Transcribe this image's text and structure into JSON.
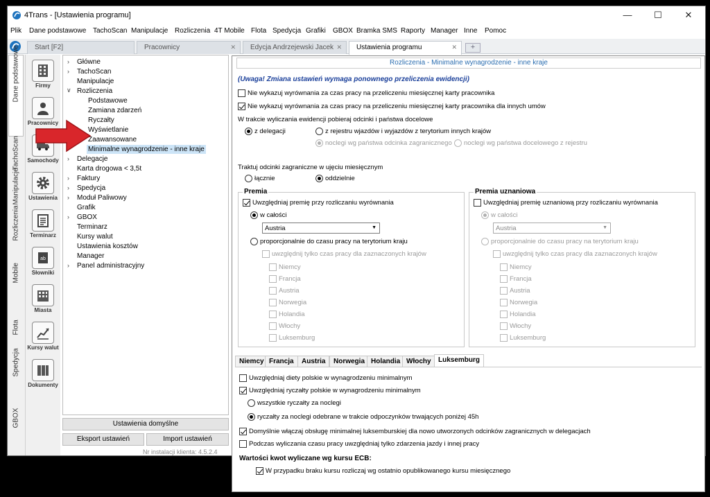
{
  "window": {
    "title": "4Trans - [Ustawienia programu]"
  },
  "menu": [
    "Plik",
    "Dane podstawowe",
    "TachoScan",
    "Manipulacje",
    "Rozliczenia",
    "4T Mobile",
    "Flota",
    "Spedycja",
    "Grafiki",
    "GBOX",
    "Bramka SMS",
    "Raporty",
    "Manager",
    "Inne",
    "Pomoc"
  ],
  "tabs": [
    {
      "label": "Start [F2]",
      "closable": false
    },
    {
      "label": "Pracownicy",
      "closable": true
    },
    {
      "label": "Edycja Andrzejewski Jacek",
      "closable": true
    },
    {
      "label": "Ustawienia programu",
      "closable": true,
      "active": true
    }
  ],
  "vertical_tabs": [
    "Dane podstawowe",
    "TachoScan",
    "Manipulacje",
    "Rozliczenia",
    "Mobile",
    "Flota",
    "Spedycja",
    "GBOX"
  ],
  "icon_buttons": [
    {
      "label": "Firmy",
      "icon": "building-icon"
    },
    {
      "label": "Pracownicy",
      "icon": "person-icon"
    },
    {
      "label": "Samochody",
      "icon": "truck-icon"
    },
    {
      "label": "Ustawienia",
      "icon": "gear-icon"
    },
    {
      "label": "Terminarz",
      "icon": "calendar-icon"
    },
    {
      "label": "Słowniki",
      "icon": "dictionary-icon"
    },
    {
      "label": "Miasta",
      "icon": "city-icon"
    },
    {
      "label": "Kursy walut",
      "icon": "chart-icon"
    },
    {
      "label": "Dokumenty",
      "icon": "documents-icon"
    }
  ],
  "tree": [
    {
      "label": "Główne",
      "level": 0,
      "chevron": "right"
    },
    {
      "label": "TachoScan",
      "level": 0,
      "chevron": "right"
    },
    {
      "label": "Manipulacje",
      "level": 0,
      "chevron": ""
    },
    {
      "label": "Rozliczenia",
      "level": 0,
      "chevron": "down"
    },
    {
      "label": "Podstawowe",
      "level": 1,
      "chevron": ""
    },
    {
      "label": "Zamiana zdarzeń",
      "level": 1,
      "chevron": ""
    },
    {
      "label": "Ryczałty",
      "level": 1,
      "chevron": ""
    },
    {
      "label": "Wyświetlanie",
      "level": 1,
      "chevron": ""
    },
    {
      "label": "Zaawansowane",
      "level": 1,
      "chevron": ""
    },
    {
      "label": "Minimalne wynagrodzenie - inne kraje",
      "level": 1,
      "chevron": "",
      "selected": true
    },
    {
      "label": "Delegacje",
      "level": 0,
      "chevron": "right"
    },
    {
      "label": "Karta drogowa < 3,5t",
      "level": 0,
      "chevron": ""
    },
    {
      "label": "Faktury",
      "level": 0,
      "chevron": "right"
    },
    {
      "label": "Spedycja",
      "level": 0,
      "chevron": "right"
    },
    {
      "label": "Moduł Paliwowy",
      "level": 0,
      "chevron": "right"
    },
    {
      "label": "Grafik",
      "level": 0,
      "chevron": ""
    },
    {
      "label": "GBOX",
      "level": 0,
      "chevron": "right"
    },
    {
      "label": "Terminarz",
      "level": 0,
      "chevron": ""
    },
    {
      "label": "Kursy walut",
      "level": 0,
      "chevron": ""
    },
    {
      "label": "Ustawienia kosztów",
      "level": 0,
      "chevron": ""
    },
    {
      "label": "Manager",
      "level": 0,
      "chevron": ""
    },
    {
      "label": "Panel administracyjny",
      "level": 0,
      "chevron": "right"
    }
  ],
  "left_buttons": {
    "defaults": "Ustawienia domyślne",
    "export": "Eksport ustawień",
    "import": "Import ustawień"
  },
  "install_no": "Nr instalacji klienta: 4.5.2.4",
  "panel": {
    "header": "Rozliczenia - Minimalne wynagrodzenie - inne kraje",
    "warning": "(Uwaga! Zmiana ustawień wymaga ponownego przeliczenia ewidencji)",
    "cb1": {
      "label": "Nie wykazuj wyrównania za czas pracy na przeliczeniu miesięcznej karty pracownika",
      "checked": false
    },
    "cb2": {
      "label": "Nie wykazuj wyrównania za czas pracy na przeliczeniu miesięcznej karty pracownika dla innych umów",
      "checked": true
    },
    "section1": "W trakcie wyliczania ewidencji pobieraj odcinki i państwa docelowe",
    "r_delegacji": "z delegacji",
    "r_rejestru": "z rejestru wjazdów i wyjazdów z terytorium innych krajów",
    "r_noclegi_odcinka": "noclegi wg państwa odcinka zagranicznego",
    "r_noclegi_docelowego": "noclegi wg państwa docelowego z rejestru",
    "section2": "Traktuj odcinki zagraniczne w ujęciu miesięcznym",
    "r_lacznie": "łącznie",
    "r_oddzielnie": "oddzielnie",
    "premia": {
      "title": "Premia",
      "include": "Uwzględniaj premię przy rozliczaniu wyrównania",
      "w_calosci": "w całości",
      "country": "Austria",
      "proportional": "proporcjonalnie do czasu pracy na terytorium kraju",
      "only_selected": "uwzględnij tylko czas pracy dla zaznaczonych krajów",
      "countries": [
        "Niemcy",
        "Francja",
        "Austria",
        "Norwegia",
        "Holandia",
        "Włochy",
        "Luksemburg"
      ]
    },
    "premia_uzn": {
      "title": "Premia uznaniowa",
      "include": "Uwzględniaj premię uznaniową przy rozliczaniu wyrównania",
      "w_calosci": "w całości",
      "country": "Austria",
      "proportional": "proporcjonalnie do czasu pracy na terytorium kraju",
      "only_selected": "uwzględnij tylko czas pracy dla zaznaczonych krajów",
      "countries": [
        "Niemcy",
        "Francja",
        "Austria",
        "Norwegia",
        "Holandia",
        "Włochy",
        "Luksemburg"
      ]
    },
    "country_tabs": [
      "Niemcy",
      "Francja",
      "Austria",
      "Norwegia",
      "Holandia",
      "Włochy",
      "Luksemburg"
    ],
    "active_country_tab": "Luksemburg",
    "lux": {
      "diety": "Uwzględniaj diety polskie w wynagrodzeniu minimalnym",
      "ryczalty": "Uwzględniaj ryczałty polskie w wynagrodzeniu minimalnym",
      "wszystkie": "wszystkie ryczałty za noclegi",
      "odebrane": "ryczałty za noclegi odebrane w trakcie odpoczynków trwających poniżej 45h",
      "domyslnie": "Domyślnie włączaj obsługę minimalnej luksemburskiej dla nowo utworzonych odcinków zagranicznych w delegacjach",
      "zdarzenia": "Podczas wyliczania czasu pracy uwzględniaj tylko zdarzenia jazdy i innej pracy",
      "ecb_title": "Wartości kwot wyliczane wg kursu ECB:",
      "ecb_cb": "W przypadku braku kursu rozliczaj wg ostatnio opublikowanego kursu miesięcznego"
    }
  },
  "colors": {
    "accent": "#2a6db0",
    "selection": "#cce4f7",
    "arrow": "#d9262b"
  }
}
